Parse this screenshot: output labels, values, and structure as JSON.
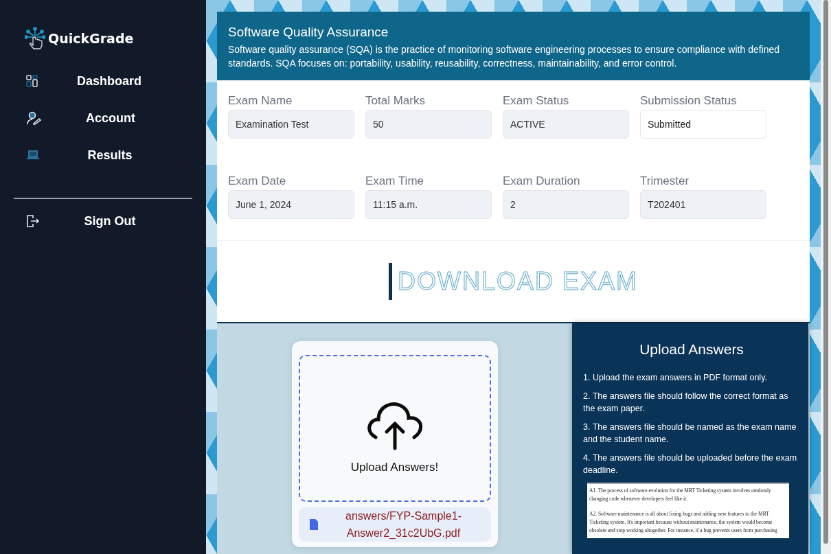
{
  "sidebar": {
    "brand": "QuickGrade",
    "items": [
      {
        "label": "Dashboard",
        "kind": "dashboard"
      },
      {
        "label": "Account",
        "kind": "account"
      },
      {
        "label": "Results",
        "kind": "results"
      }
    ],
    "sign_out": "Sign Out"
  },
  "course": {
    "title": "Software Quality Assurance",
    "description": "Software quality assurance (SQA) is the practice of monitoring software engineering processes to ensure compliance with defined standards. SQA focuses on: portability, usability, reusability, correctness, maintainability, and error control."
  },
  "fields": [
    {
      "label": "Exam Name",
      "value": "Examination Test",
      "disabled": true
    },
    {
      "label": "Total Marks",
      "value": "50",
      "disabled": true
    },
    {
      "label": "Exam Status",
      "value": "ACTIVE",
      "disabled": true
    },
    {
      "label": "Submission Status",
      "value": "Submitted",
      "disabled": false
    },
    {
      "label": "Exam Date",
      "value": "June 1, 2024",
      "disabled": true
    },
    {
      "label": "Exam Time",
      "value": "11:15 a.m.",
      "disabled": true
    },
    {
      "label": "Exam Duration",
      "value": "2",
      "disabled": true
    },
    {
      "label": "Trimester",
      "value": "T202401",
      "disabled": true
    }
  ],
  "download": {
    "label": "DOWNLOAD EXAM"
  },
  "upload": {
    "drop_label": "Upload Answers!",
    "file_name": "answers/FYP-Sample1-Answer2_31c2UbG.pdf"
  },
  "instructions": {
    "title": "Upload Answers",
    "items": [
      "1. Upload the exam answers in PDF format only.",
      "2. The answers file should follow the correct format as the exam paper.",
      "3. The answers file should be named as the exam name and the student name.",
      "4. The answers file should be uploaded before the exam deadline."
    ],
    "preview": [
      "A1. The process of software evolution for the MRT Ticketing system involves randomly changing code whenever developers feel like it.",
      "A2. Software maintenance is all about fixing bugs and adding new features to the MRT Ticketing system. It's important because without maintenance, the system would become obsolete and stop working altogether. For instance, if a bug prevents users from purchasing"
    ]
  }
}
